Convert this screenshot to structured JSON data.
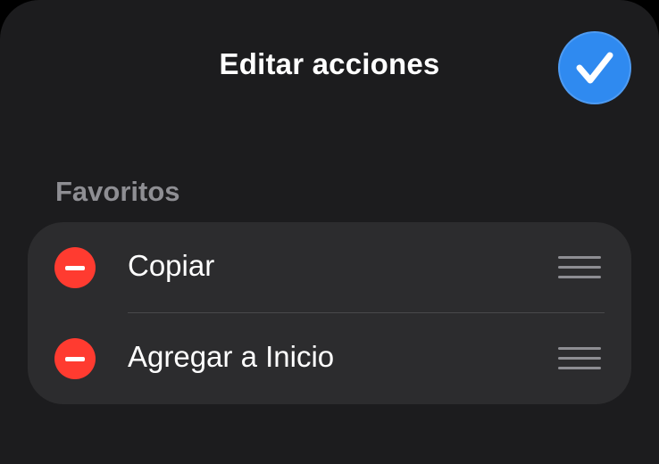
{
  "sheet": {
    "title": "Editar acciones",
    "done_button": {
      "icon": "checkmark-icon",
      "color": "#2f8af0"
    }
  },
  "favorites": {
    "header": "Favoritos",
    "items": [
      {
        "label": "Copiar",
        "remove_icon": "minus-circle-icon",
        "handle_icon": "reorder-icon"
      },
      {
        "label": "Agregar a Inicio",
        "remove_icon": "minus-circle-icon",
        "handle_icon": "reorder-icon"
      }
    ]
  },
  "colors": {
    "background": "#1c1c1e",
    "group": "#2c2c2e",
    "remove": "#ff3b30",
    "secondary_text": "#8e8e93"
  }
}
